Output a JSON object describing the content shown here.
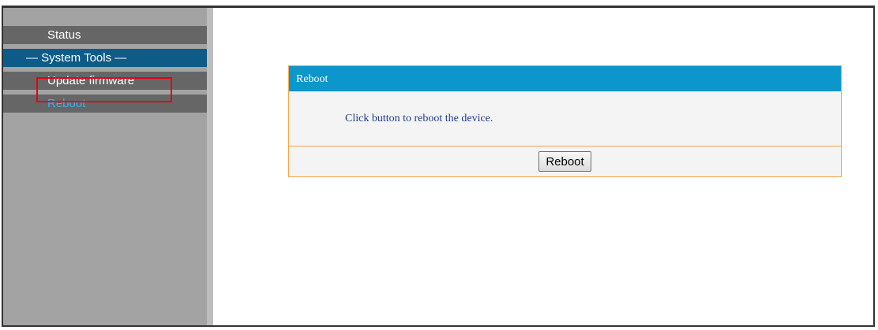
{
  "sidebar": {
    "items": [
      {
        "label": "Status"
      },
      {
        "label": "— System Tools —"
      },
      {
        "label": "Update firmware"
      },
      {
        "label": "Reboot"
      }
    ]
  },
  "panel": {
    "title": "Reboot",
    "message": "Click button to reboot the device.",
    "button_label": "Reboot"
  },
  "colors": {
    "section_bg": "#0e5b87",
    "active_text": "#33b5ee",
    "panel_header": "#0b96cc",
    "panel_border": "#f4a445",
    "highlight": "#e4001a"
  }
}
